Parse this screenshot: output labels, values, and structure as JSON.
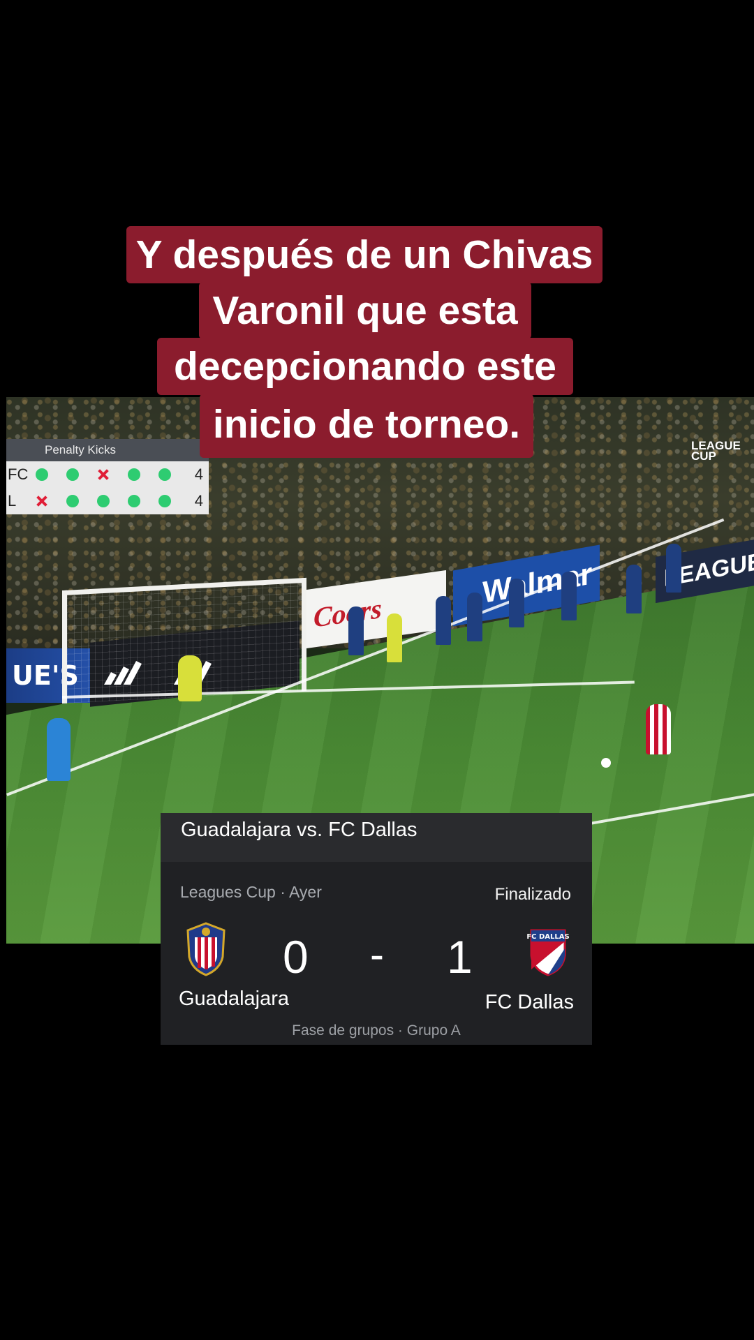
{
  "caption": {
    "lines": [
      "Y después de un Chivas",
      "Varonil que esta",
      "decepcionando este",
      "inicio de torneo."
    ]
  },
  "broadcast": {
    "penalty_title": "Penalty Kicks",
    "rows": [
      {
        "team": "FC",
        "marks": [
          "goal",
          "goal",
          "miss",
          "goal",
          "goal"
        ],
        "score": "4"
      },
      {
        "team": "L",
        "marks": [
          "miss",
          "goal",
          "goal",
          "goal",
          "goal"
        ],
        "score": "4"
      }
    ],
    "league_cup_logo": "LEAGUE CUP",
    "boards": {
      "left": "UE'S",
      "coors": "Coors",
      "walmart": "Walmar",
      "league": "LEAGUE"
    }
  },
  "match_card": {
    "title": "Guadalajara vs. FC Dallas",
    "meta": "Leagues Cup · Ayer",
    "status": "Finalizado",
    "home": {
      "name": "Guadalajara",
      "score": "0"
    },
    "dash": "-",
    "away": {
      "name": "FC Dallas",
      "score": "1"
    },
    "footer": "Fase de grupos · Grupo A",
    "colors": {
      "card_bg": "#202124",
      "header_bg": "#2a2b2e",
      "caption_bg": "#8b1c2d"
    }
  }
}
